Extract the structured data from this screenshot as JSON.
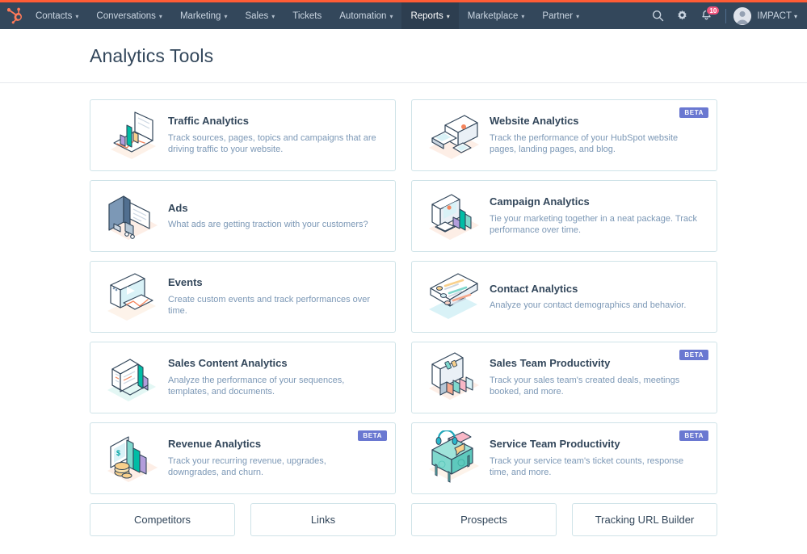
{
  "nav": {
    "logo_icon": "hubspot-sprocket-logo",
    "items": [
      {
        "label": "Contacts",
        "has_caret": true,
        "active": false
      },
      {
        "label": "Conversations",
        "has_caret": true,
        "active": false
      },
      {
        "label": "Marketing",
        "has_caret": true,
        "active": false
      },
      {
        "label": "Sales",
        "has_caret": true,
        "active": false
      },
      {
        "label": "Tickets",
        "has_caret": false,
        "active": false
      },
      {
        "label": "Automation",
        "has_caret": true,
        "active": false
      },
      {
        "label": "Reports",
        "has_caret": true,
        "active": true
      },
      {
        "label": "Marketplace",
        "has_caret": true,
        "active": false
      },
      {
        "label": "Partner",
        "has_caret": true,
        "active": false
      }
    ],
    "search_icon": "search-icon",
    "settings_icon": "gear-icon",
    "notifications_icon": "bell-icon",
    "notifications_count": "10",
    "account_name": "IMPACT",
    "caret": "▾"
  },
  "header": {
    "title": "Analytics Tools"
  },
  "colors": {
    "navbar_bg": "#33475b",
    "navbar_accent": "#ff5c35",
    "card_border": "#cfe3e8",
    "title_text": "#33475b",
    "desc_text": "#7c98b6",
    "beta_badge_bg": "#6a78d1",
    "notif_badge_bg": "#f2547d"
  },
  "cards": [
    {
      "title": "Traffic Analytics",
      "desc": "Track sources, pages, topics and campaigns that are driving traffic to your website.",
      "beta": null,
      "illo": "traffic-analytics-illustration"
    },
    {
      "title": "Website Analytics",
      "desc": "Track the performance of your HubSpot website pages, landing pages, and blog.",
      "beta": "BETA",
      "illo": "website-analytics-illustration"
    },
    {
      "title": "Ads",
      "desc": "What ads are getting traction with your customers?",
      "beta": null,
      "illo": "ads-illustration"
    },
    {
      "title": "Campaign Analytics",
      "desc": "Tie your marketing together in a neat package. Track performance over time.",
      "beta": null,
      "illo": "campaign-analytics-illustration"
    },
    {
      "title": "Events",
      "desc": "Create custom events and track performances over time.",
      "beta": null,
      "illo": "events-illustration"
    },
    {
      "title": "Contact Analytics",
      "desc": "Analyze your contact demographics and behavior.",
      "beta": null,
      "illo": "contact-analytics-illustration"
    },
    {
      "title": "Sales Content Analytics",
      "desc": "Analyze the performance of your sequences, templates, and documents.",
      "beta": null,
      "illo": "sales-content-analytics-illustration"
    },
    {
      "title": "Sales Team Productivity",
      "desc": "Track your sales team's created deals, meetings booked, and more.",
      "beta": "BETA",
      "illo": "sales-team-productivity-illustration"
    },
    {
      "title": "Revenue Analytics",
      "desc": "Track your recurring revenue, upgrades, downgrades, and churn.",
      "beta": "BETA",
      "illo": "revenue-analytics-illustration"
    },
    {
      "title": "Service Team Productivity",
      "desc": "Track your service team's ticket counts, response time, and more.",
      "beta": "BETA",
      "illo": "service-team-productivity-illustration"
    }
  ],
  "tool_buttons": [
    {
      "label": "Competitors"
    },
    {
      "label": "Links"
    },
    {
      "label": "Prospects"
    },
    {
      "label": "Tracking URL Builder"
    }
  ]
}
